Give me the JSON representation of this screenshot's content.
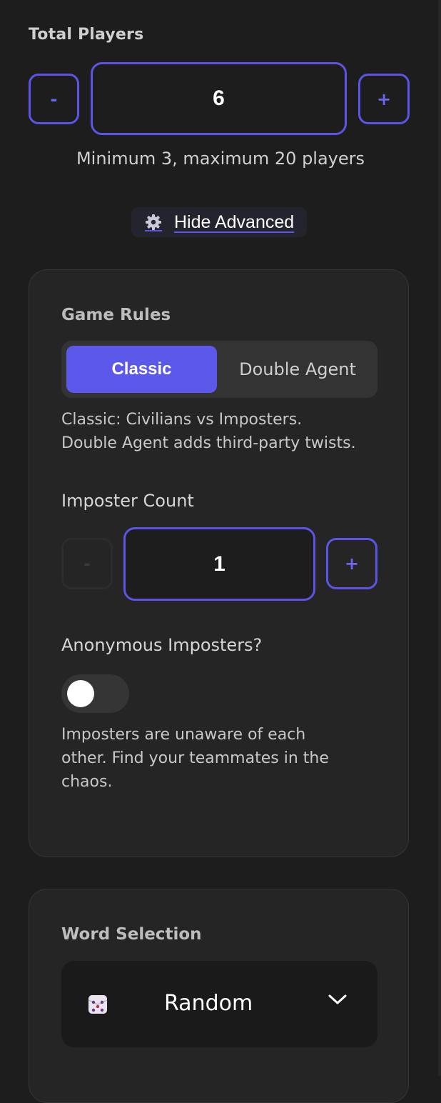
{
  "players": {
    "label": "Total Players",
    "minus_label": "-",
    "plus_label": "+",
    "value": "6",
    "hint": "Minimum 3, maximum 20 players"
  },
  "advanced": {
    "label": "Hide Advanced",
    "icon": "gear-icon"
  },
  "rules_card": {
    "title": "Game Rules",
    "options": [
      "Classic",
      "Double Agent"
    ],
    "selected": "Classic",
    "description_line1": "Classic: Civilians vs Imposters.",
    "description_line2": "Double Agent adds third-party twists.",
    "imposter_count": {
      "label": "Imposter Count",
      "minus_label": "-",
      "plus_label": "+",
      "value": "1"
    },
    "anonymous": {
      "label": "Anonymous Imposters?",
      "enabled": false,
      "description_line1": "Imposters are unaware of each",
      "description_line2": "other. Find your teammates in the",
      "description_line3": "chaos."
    }
  },
  "word_card": {
    "title": "Word Selection",
    "selected_value": "Random",
    "icon": "dice-icon"
  },
  "colors": {
    "accent": "#5b58ea",
    "background": "#1d1d1d",
    "card": "#252525"
  }
}
